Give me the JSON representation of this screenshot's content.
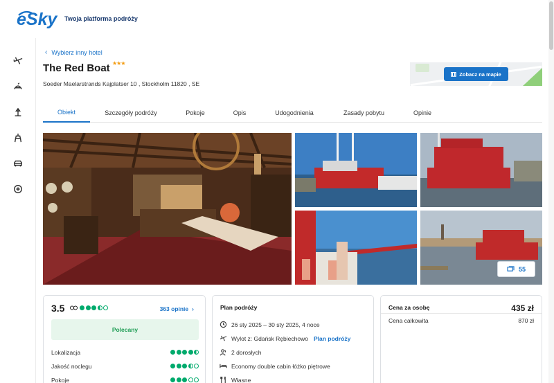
{
  "header": {
    "brand": "eSky",
    "tagline": "Twoja platforma podróży"
  },
  "sidebar": {
    "items": [
      {
        "icon": "plane-icon"
      },
      {
        "icon": "flight-hotel-icon"
      },
      {
        "icon": "vacation-icon"
      },
      {
        "icon": "city-break-icon"
      },
      {
        "icon": "car-icon"
      },
      {
        "icon": "more-icon"
      }
    ]
  },
  "hotel": {
    "back_link": "Wybierz inny hotel",
    "name": "The Red Boat",
    "stars": "★★★",
    "address": "Soeder Maelarstrands Kajplatser 10 , Stockholm 11820 , SE",
    "map_button": "Zobacz na mapie"
  },
  "tabs": [
    {
      "label": "Obiekt",
      "active": true
    },
    {
      "label": "Szczegóły podróży"
    },
    {
      "label": "Pokoje"
    },
    {
      "label": "Opis"
    },
    {
      "label": "Udogodnienia"
    },
    {
      "label": "Zasady pobytu"
    },
    {
      "label": "Opinie"
    }
  ],
  "gallery": {
    "photo_count": "55"
  },
  "rating_card": {
    "score": "3.5",
    "score_dots": 3.5,
    "reviews_link": "363 opinie",
    "recommended": "Polecany",
    "categories": [
      {
        "label": "Lokalizacja",
        "value": 4.5
      },
      {
        "label": "Jakość noclegu",
        "value": 3.5
      },
      {
        "label": "Pokoje",
        "value": 3
      }
    ]
  },
  "plan_card": {
    "title": "Plan podróży",
    "dates": "26 sty 2025 – 30 sty 2025, 4 noce",
    "departure": "Wylot z: Gdańsk Rębiechowo",
    "plan_link": "Plan podróży",
    "guests": "2 dorosłych",
    "room": "Economy double cabin łóżko piętrowe",
    "board": "Własne"
  },
  "price_card": {
    "per_person_label": "Cena za osobę",
    "per_person": "435 zł",
    "total_label": "Cena całkowita",
    "total": "870 zł"
  },
  "colors": {
    "accent": "#1a73c8",
    "rating_green": "#00aa6c",
    "stars": "#f39c12"
  }
}
